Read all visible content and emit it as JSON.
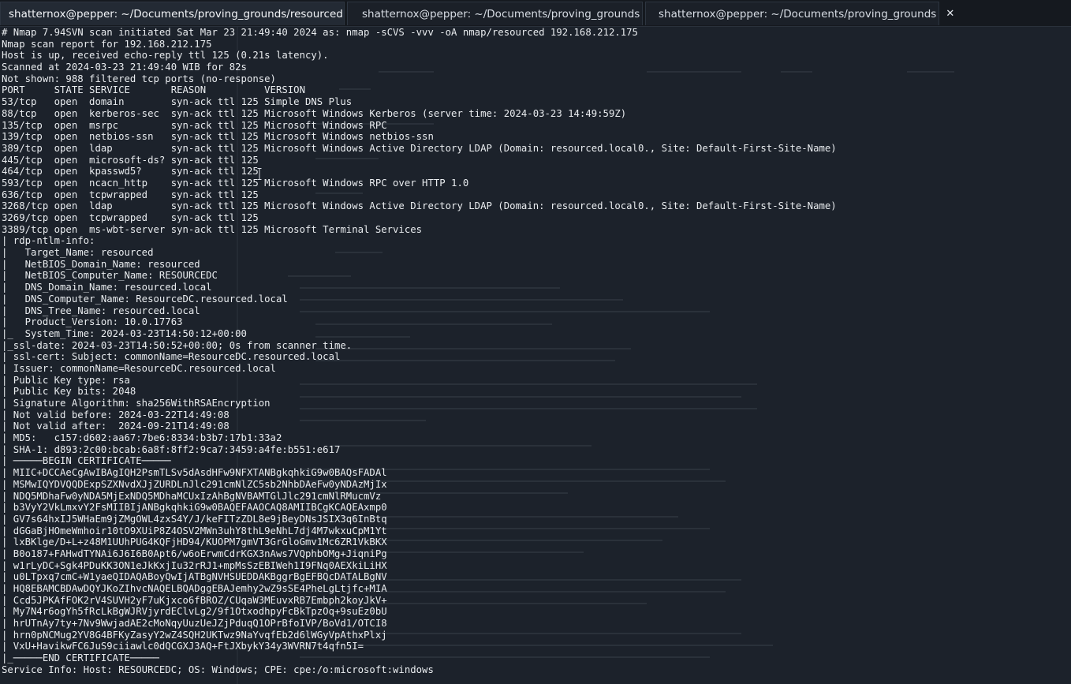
{
  "tabs": [
    {
      "label": "shatternox@pepper: ~/Documents/proving_grounds/resourced",
      "close": "✕",
      "active": true
    },
    {
      "label": "shatternox@pepper: ~/Documents/proving_grounds",
      "close": "✕",
      "active": false
    },
    {
      "label": "shatternox@pepper: ~/Documents/proving_grounds",
      "close": "✕",
      "active": false
    }
  ],
  "terminal": {
    "lines": [
      "# Nmap 7.94SVN scan initiated Sat Mar 23 21:49:40 2024 as: nmap -sCVS -vvv -oA nmap/resourced 192.168.212.175",
      "Nmap scan report for 192.168.212.175",
      "Host is up, received echo-reply ttl 125 (0.21s latency).",
      "Scanned at 2024-03-23 21:49:40 WIB for 82s",
      "Not shown: 988 filtered tcp ports (no-response)",
      "PORT     STATE SERVICE       REASON          VERSION",
      "53/tcp   open  domain        syn-ack ttl 125 Simple DNS Plus",
      "88/tcp   open  kerberos-sec  syn-ack ttl 125 Microsoft Windows Kerberos (server time: 2024-03-23 14:49:59Z)",
      "135/tcp  open  msrpc         syn-ack ttl 125 Microsoft Windows RPC",
      "139/tcp  open  netbios-ssn   syn-ack ttl 125 Microsoft Windows netbios-ssn",
      "389/tcp  open  ldap          syn-ack ttl 125 Microsoft Windows Active Directory LDAP (Domain: resourced.local0., Site: Default-First-Site-Name)",
      "445/tcp  open  microsoft-ds? syn-ack ttl 125",
      "464/tcp  open  kpasswd5?     syn-ack ttl 125",
      "593/tcp  open  ncacn_http    syn-ack ttl 125 Microsoft Windows RPC over HTTP 1.0",
      "636/tcp  open  tcpwrapped    syn-ack ttl 125",
      "3268/tcp open  ldap          syn-ack ttl 125 Microsoft Windows Active Directory LDAP (Domain: resourced.local0., Site: Default-First-Site-Name)",
      "3269/tcp open  tcpwrapped    syn-ack ttl 125",
      "3389/tcp open  ms-wbt-server syn-ack ttl 125 Microsoft Terminal Services",
      "| rdp-ntlm-info:",
      "|   Target_Name: resourced",
      "|   NetBIOS_Domain_Name: resourced",
      "|   NetBIOS_Computer_Name: RESOURCEDC",
      "|   DNS_Domain_Name: resourced.local",
      "|   DNS_Computer_Name: ResourceDC.resourced.local",
      "|   DNS_Tree_Name: resourced.local",
      "|   Product_Version: 10.0.17763",
      "|_  System_Time: 2024-03-23T14:50:12+00:00",
      "|_ssl-date: 2024-03-23T14:50:52+00:00; 0s from scanner time.",
      "| ssl-cert: Subject: commonName=ResourceDC.resourced.local",
      "| Issuer: commonName=ResourceDC.resourced.local",
      "| Public Key type: rsa",
      "| Public Key bits: 2048",
      "| Signature Algorithm: sha256WithRSAEncryption",
      "| Not valid before: 2024-03-22T14:49:08",
      "| Not valid after:  2024-09-21T14:49:08",
      "| MD5:   c157:d602:aa67:7be6:8334:b3b7:17b1:33a2",
      "| SHA-1: d893:2c00:bcab:6a8f:8ff2:9ca7:3459:a4fe:b551:e617",
      "| ─────BEGIN CERTIFICATE─────",
      "| MIIC+DCCAeCgAwIBAgIQH2PsmTLSv5dAsdHFw9NFXTANBgkqhkiG9w0BAQsFADAl",
      "| MSMwIQYDVQQDExpSZXNvdXJjZURDLnJlc291cmNlZC5sb2NhbDAeFw0yNDAzMjIx",
      "| NDQ5MDhaFw0yNDA5MjExNDQ5MDhaMCUxIzAhBgNVBAMTGlJlc291cmNlRMucmVz",
      "| b3VyY2VkLmxvY2FsMIIBIjANBgkqhkiG9w0BAQEFAAOCAQ8AMIIBCgKCAQEAxmp0",
      "| GV7s64hxIJ5WHaEm9jZMgOWL4zxS4Y/J/keFITzZDL8e9jBeyDNsJSIX3q6InBtq",
      "| dGGaBjHOmeWmhoir10tO9XUiP8Z4OSV2MWn3uhY8thL9eNhL7dj4M7wkxuCpM1Yt",
      "| lxBKlge/D+L+z48M1UUhPUG4KQFjHD94/KUOPM7gmVT3GrGloGmv1Mc6ZR1VkBKX",
      "| B0o187+FAHwdTYNAi6J6I6B0Apt6/w6oErwmCdrKGX3nAws7VQphbOMg+JiqniPg",
      "| w1rLyDC+Sgk4PDuKK3ON1eJkKxjIu32rRJ1+mpMsSzEBIWeh1I9FNq0AEXkiLiHX",
      "| u0LTpxq7cmC+W1yaeQIDAQABoyQwIjATBgNVHSUEDDAKBggrBgEFBQcDATALBgNV",
      "| HQ8EBAMCBDAwDQYJKoZIhvcNAQELBQADggEBAJemhy2wZ9sSE4PheLgLtjfc+MIA",
      "| Ccd5JPKAfFOK2rV4SUVH2yF7uKjxco6fBROZ/CUqaW3MEuvxRB7Embph2koyJkV+",
      "| My7N4r6ogYh5fRcLkBgWJRVjyrdEClvLg2/9f1OtxodhpyFcBkTpzOq+9suEz0bU",
      "| hrUTnAy7ty+7Nv9WwjadAE2cMoNqyUuzUeJZjPduqQ1OPrBfoIVP/BoVd1/OTCI8",
      "| hrn0pNCMug2YV8G4BFKyZasyY2wZ4SQH2UKTwz9NaYvqfEb2d6lWGyVpAthxPlxj",
      "| VxU+HavikwFC6JuS9ciiawlc0dQCGXJ3AQ+FtJXbykY34y3WVRN7t4qfn5I=",
      "|_─────END CERTIFICATE─────",
      "Service Info: Host: RESOURCEDC; OS: Windows; CPE: cpe:/o:microsoft:windows"
    ]
  }
}
